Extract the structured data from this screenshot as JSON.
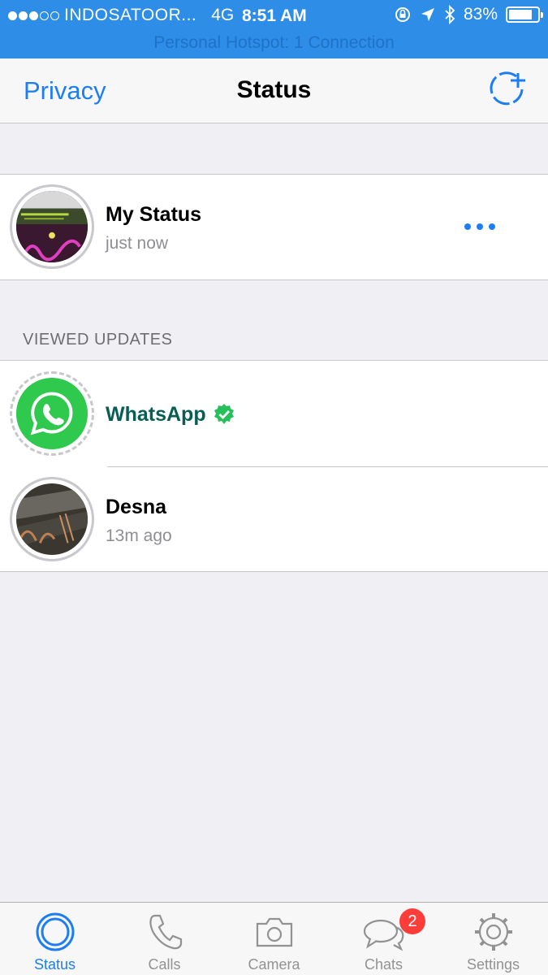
{
  "status_bar": {
    "carrier": "INDOSATOOR...",
    "network": "4G",
    "time": "8:51 AM",
    "battery_text": "83%",
    "battery_level": 0.83,
    "signal_bars_filled": 3,
    "signal_bars_total": 5,
    "hotspot_text": "Personal Hotspot: 1 Connection"
  },
  "nav": {
    "left_label": "Privacy",
    "title": "Status",
    "add_icon": "new-status-icon"
  },
  "my_status": {
    "name": "My Status",
    "time": "just now",
    "more_icon": "more-dots-icon"
  },
  "viewed_header": "VIEWED UPDATES",
  "updates": [
    {
      "name": "WhatsApp",
      "verified": true,
      "time": ""
    },
    {
      "name": "Desna",
      "verified": false,
      "time": "13m ago"
    }
  ],
  "tabs": [
    {
      "label": "Status",
      "icon": "status-icon",
      "active": true
    },
    {
      "label": "Calls",
      "icon": "phone-icon",
      "active": false
    },
    {
      "label": "Camera",
      "icon": "camera-icon",
      "active": false
    },
    {
      "label": "Chats",
      "icon": "chat-bubbles-icon",
      "active": false
    },
    {
      "label": "Settings",
      "icon": "gear-icon",
      "active": false
    }
  ],
  "chats_badge": "2",
  "colors": {
    "accent": "#1d7ef3",
    "status_bar": "#2d8de7",
    "whatsapp_green": "#25d366",
    "whatsapp_name": "#075e54",
    "badge": "#fc3d39"
  }
}
